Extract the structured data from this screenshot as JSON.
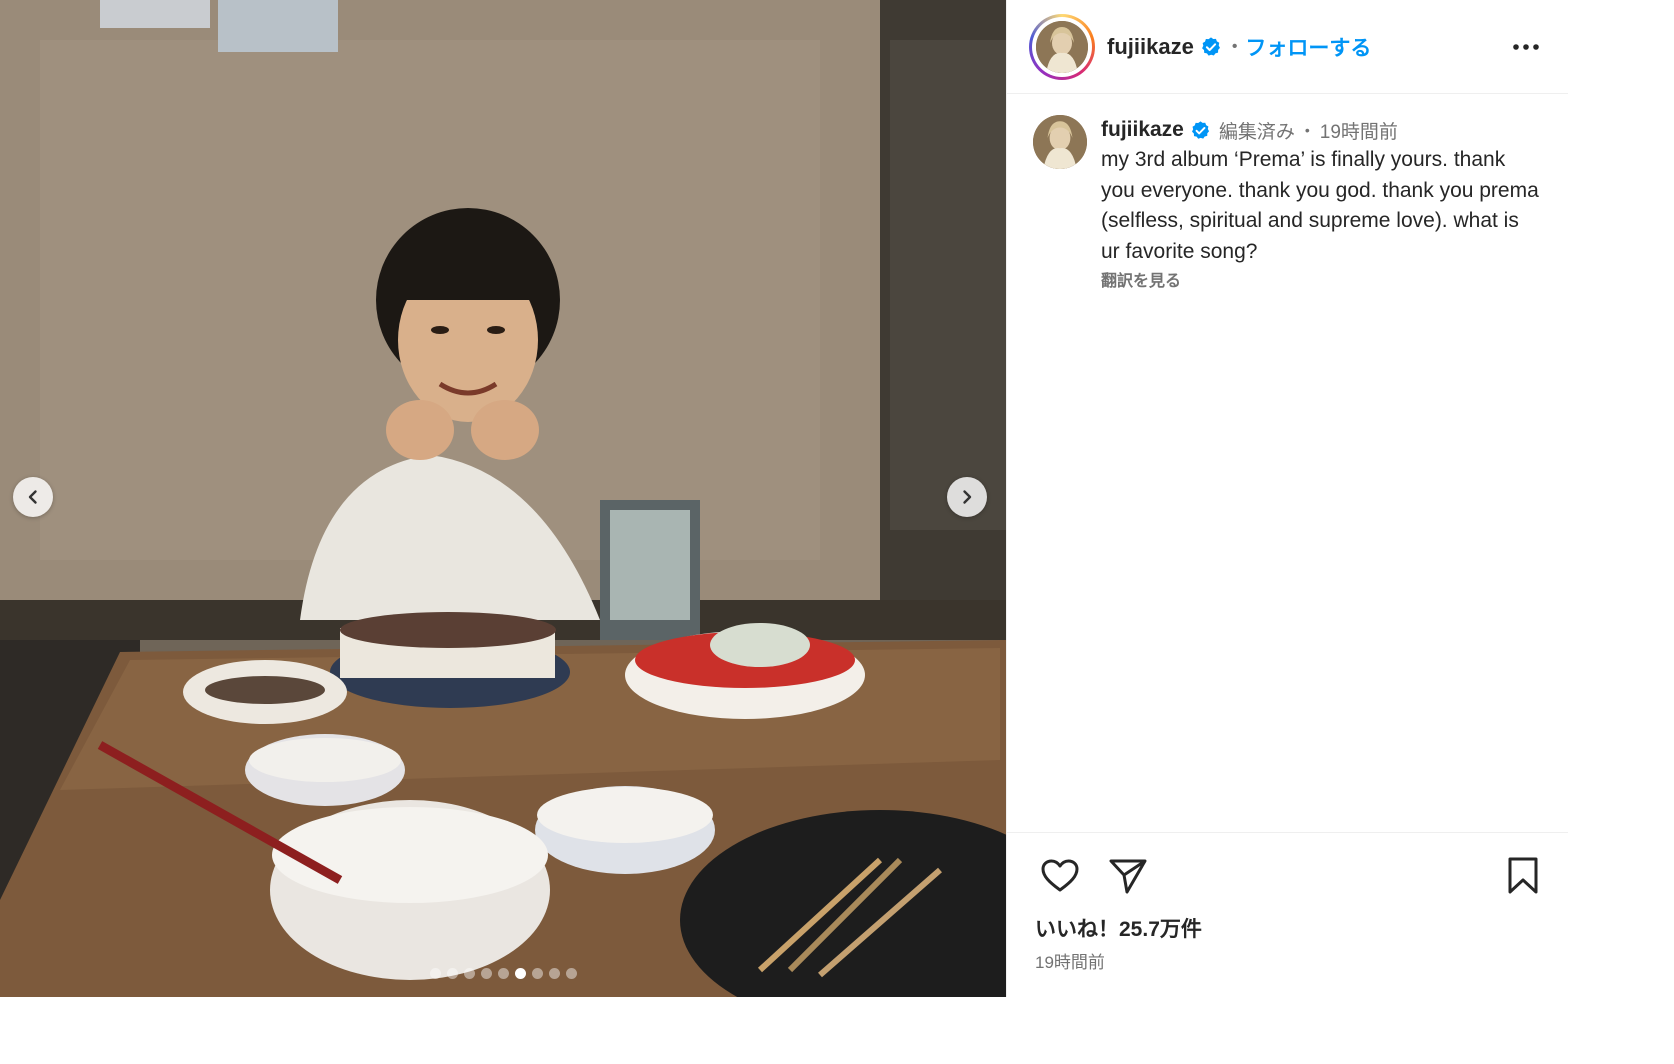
{
  "post": {
    "author": {
      "username": "fujiikaze",
      "verified": true
    },
    "header": {
      "follow_label": "フォローする",
      "separator": "•"
    },
    "caption": {
      "edited_label": "編集済み",
      "separator": "•",
      "time": "19時間前",
      "text": "my 3rd album ‘Prema’ is finally yours. thank you everyone. thank you god. thank you prema (selfless, spiritual and supreme love). what is ur favorite song?",
      "translate_label": "翻訳を見る"
    },
    "carousel": {
      "slide_count": 9,
      "active_index": 5
    },
    "stats": {
      "likes_label": "いいね！25.7万件",
      "posted_time": "19時間前"
    }
  },
  "colors": {
    "link_blue": "#0095f6",
    "verified_blue": "#0095f6",
    "text": "#262626",
    "secondary": "#737373"
  },
  "icons": [
    "chevron-left-icon",
    "chevron-right-icon",
    "verified-badge-icon",
    "more-options-icon",
    "heart-icon",
    "share-icon",
    "bookmark-icon"
  ]
}
